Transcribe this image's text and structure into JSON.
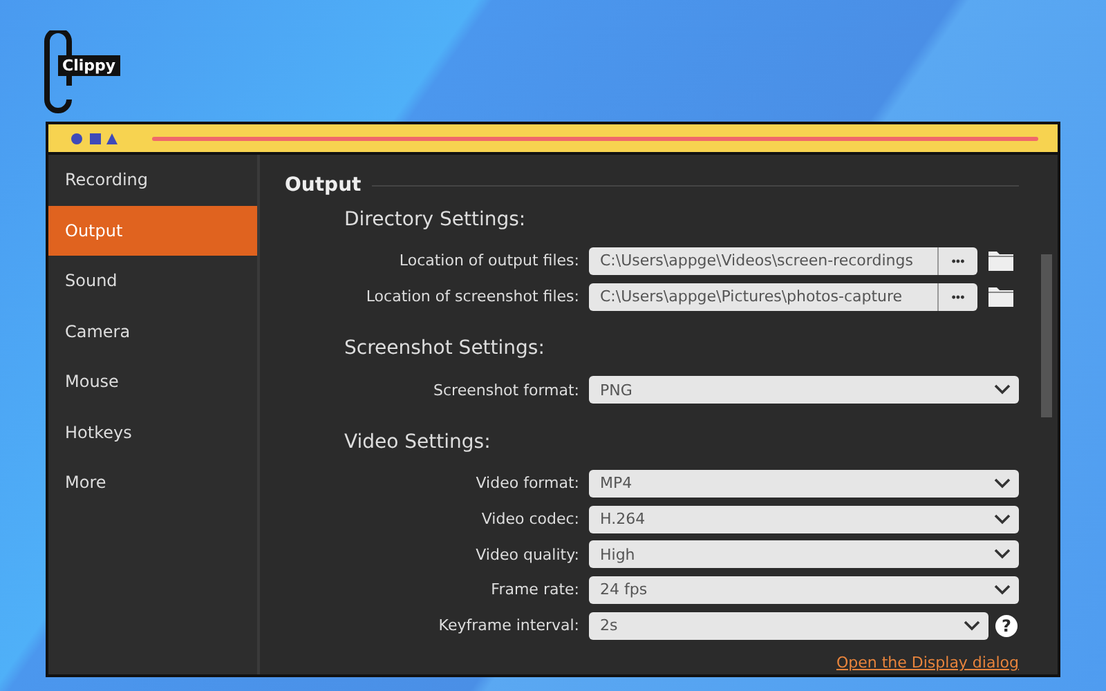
{
  "logo": {
    "text": "Clippy"
  },
  "sidebar": {
    "items": [
      {
        "label": "Recording",
        "selected": false
      },
      {
        "label": "Output",
        "selected": true
      },
      {
        "label": "Sound",
        "selected": false
      },
      {
        "label": "Camera",
        "selected": false
      },
      {
        "label": "Mouse",
        "selected": false
      },
      {
        "label": "Hotkeys",
        "selected": false
      },
      {
        "label": "More",
        "selected": false
      }
    ]
  },
  "page": {
    "title": "Output",
    "sections": [
      {
        "title": "Directory Settings:",
        "rows": [
          {
            "kind": "path",
            "label": "Location of output files:",
            "value": "C:\\Users\\appge\\Videos\\screen-recordings",
            "browse": "•••"
          },
          {
            "kind": "path",
            "label": "Location of screenshot files:",
            "value": "C:\\Users\\appge\\Pictures\\photos-capture",
            "browse": "•••"
          }
        ]
      },
      {
        "title": "Screenshot Settings:",
        "rows": [
          {
            "kind": "select",
            "label": "Screenshot format:",
            "value": "PNG"
          }
        ]
      },
      {
        "title": "Video Settings:",
        "rows": [
          {
            "kind": "select",
            "label": "Video format:",
            "value": "MP4"
          },
          {
            "kind": "select",
            "label": "Video codec:",
            "value": "H.264"
          },
          {
            "kind": "select",
            "label": "Video quality:",
            "value": "High"
          },
          {
            "kind": "select",
            "label": "Frame rate:",
            "value": "24 fps"
          },
          {
            "kind": "select",
            "label": "Keyframe interval:",
            "value": "2s",
            "help": "?"
          }
        ]
      }
    ]
  },
  "link": "Open the Display dialog"
}
